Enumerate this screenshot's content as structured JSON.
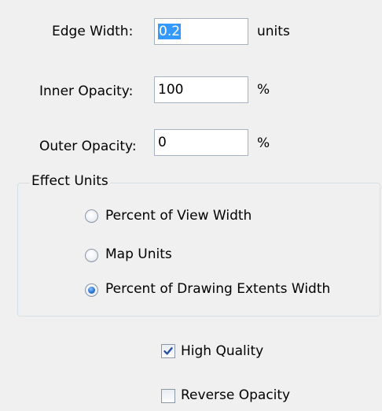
{
  "edge_width": {
    "label": "Edge Width:",
    "value": "0.2",
    "unit": "units"
  },
  "inner_opacity": {
    "label": "Inner Opacity:",
    "value": "100",
    "unit": "%"
  },
  "outer_opacity": {
    "label": "Outer Opacity:",
    "value": "0",
    "unit": "%"
  },
  "effect_units": {
    "title": "Effect Units",
    "options": [
      {
        "label": "Percent of View Width",
        "selected": false
      },
      {
        "label": "Map Units",
        "selected": false
      },
      {
        "label": "Percent of Drawing Extents Width",
        "selected": true
      }
    ]
  },
  "high_quality": {
    "label": "High Quality",
    "checked": true
  },
  "reverse_opacity": {
    "label": "Reverse Opacity",
    "checked": false
  },
  "colors": {
    "selection": "#3399ff",
    "radio_dot": "#2c72d0",
    "checkmark": "#2a4fa8"
  }
}
